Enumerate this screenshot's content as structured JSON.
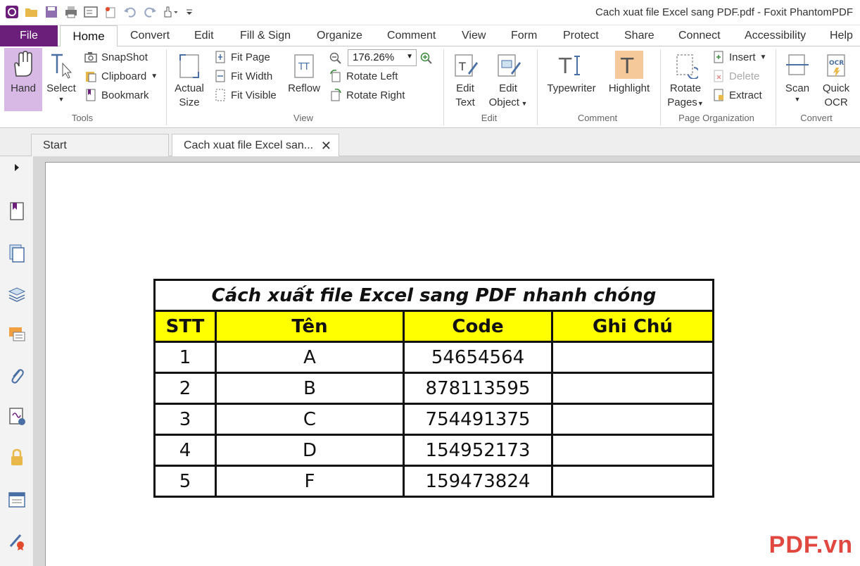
{
  "window": {
    "title": "Cach xuat file Excel sang PDF.pdf - Foxit PhantomPDF"
  },
  "menu": {
    "file": "File",
    "tabs": [
      "Home",
      "Convert",
      "Edit",
      "Fill & Sign",
      "Organize",
      "Comment",
      "View",
      "Form",
      "Protect",
      "Share",
      "Connect",
      "Accessibility",
      "Help"
    ]
  },
  "ribbon": {
    "tools": {
      "hand": "Hand",
      "select": "Select",
      "snapshot": "SnapShot",
      "clipboard": "Clipboard",
      "bookmark": "Bookmark",
      "label": "Tools"
    },
    "view": {
      "actual1": "Actual",
      "actual2": "Size",
      "fit_page": "Fit Page",
      "fit_width": "Fit Width",
      "fit_visible": "Fit Visible",
      "reflow": "Reflow",
      "zoom": "176.26%",
      "rotate_left": "Rotate Left",
      "rotate_right": "Rotate Right",
      "label": "View"
    },
    "edit": {
      "edit_text1": "Edit",
      "edit_text2": "Text",
      "edit_obj1": "Edit",
      "edit_obj2": "Object",
      "label": "Edit"
    },
    "comment": {
      "typewriter": "Typewriter",
      "highlight": "Highlight",
      "label": "Comment"
    },
    "pages": {
      "rotate1": "Rotate",
      "rotate2": "Pages",
      "insert": "Insert",
      "delete": "Delete",
      "extract": "Extract",
      "label": "Page Organization"
    },
    "convert": {
      "scan": "Scan",
      "ocr1": "Quick",
      "ocr2": "OCR",
      "label": "Convert"
    }
  },
  "doctabs": {
    "start": "Start",
    "active": "Cach xuat file Excel san..."
  },
  "document": {
    "title": "Cách xuất file Excel sang PDF nhanh chóng",
    "headers": [
      "STT",
      "Tên",
      "Code",
      "Ghi Chú"
    ],
    "rows": [
      [
        "1",
        "A",
        "54654564",
        ""
      ],
      [
        "2",
        "B",
        "878113595",
        ""
      ],
      [
        "3",
        "C",
        "754491375",
        ""
      ],
      [
        "4",
        "D",
        "154952173",
        ""
      ],
      [
        "5",
        "F",
        "159473824",
        ""
      ]
    ]
  },
  "watermark": "PDF.vn",
  "colors": {
    "file_tab": "#6b1f7a",
    "header_fill": "#ffff00",
    "watermark": "#e0473f"
  }
}
